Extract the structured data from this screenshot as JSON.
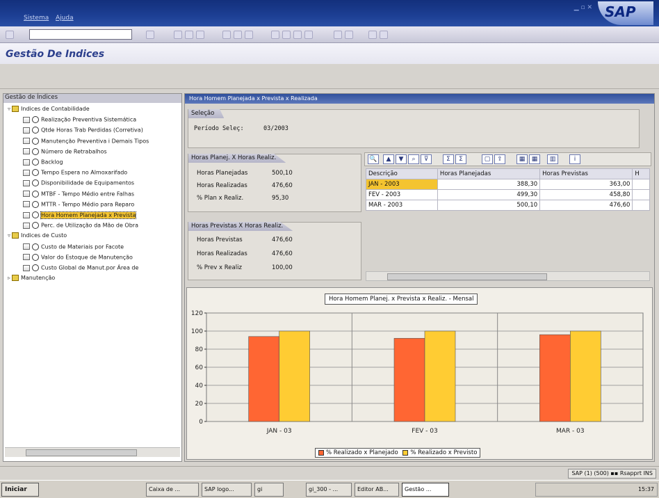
{
  "menu": {
    "items": [
      "Sistema",
      "Ajuda"
    ]
  },
  "brand": {
    "logo_text": "SAP"
  },
  "app": {
    "title": "Gestão De Indices"
  },
  "tree": {
    "header": "Gestão de Índices",
    "nodes": [
      {
        "label": "Indices de Contabilidade",
        "kind": "folder",
        "level": 0,
        "expanded": true
      },
      {
        "label": "Realização Preventiva Sistemática",
        "kind": "item",
        "level": 1
      },
      {
        "label": "Qtde Horas Trab Perdidas (Corretiva)",
        "kind": "item",
        "level": 1
      },
      {
        "label": "Manutenção Preventiva i Demais Tipos",
        "kind": "item",
        "level": 1
      },
      {
        "label": "Número de Retrabalhos",
        "kind": "item",
        "level": 1
      },
      {
        "label": "Backlog",
        "kind": "item",
        "level": 1
      },
      {
        "label": "Tempo Espera no Almoxarifado",
        "kind": "item",
        "level": 1
      },
      {
        "label": "Disponibilidade de Equipamentos",
        "kind": "item",
        "level": 1
      },
      {
        "label": "MTBF - Tempo Médio entre Falhas",
        "kind": "item",
        "level": 1
      },
      {
        "label": "MTTR - Tempo Médio para Reparo",
        "kind": "item",
        "level": 1
      },
      {
        "label": "Hora Homem Planejada x Prevista",
        "kind": "item",
        "level": 1,
        "selected": true
      },
      {
        "label": "Perc. de Utilização da Mão de Obra",
        "kind": "item",
        "level": 1
      },
      {
        "label": "Indices de Custo",
        "kind": "folder",
        "level": 0,
        "expanded": true
      },
      {
        "label": "Custo de Materiais por Facote",
        "kind": "item",
        "level": 1
      },
      {
        "label": "Valor do Estoque de Manutenção",
        "kind": "item",
        "level": 1
      },
      {
        "label": "Custo Global de Manut.por Área de",
        "kind": "item",
        "level": 1
      },
      {
        "label": "Manutenção",
        "kind": "folder",
        "level": 0,
        "expanded": false
      }
    ]
  },
  "panel": {
    "title": "Hora Homem Planejada x Prevista x Realizada",
    "selection": {
      "tab": "Seleção",
      "label": "Período Seleç:",
      "value": "03/2003"
    },
    "box1": {
      "tab": "Horas Planej. X Horas Realiz.",
      "rows": [
        {
          "label": "Horas Planejadas",
          "value": "500,10"
        },
        {
          "label": "Horas Realizadas",
          "value": "476,60"
        },
        {
          "label": "% Plan x Realiz.",
          "value": "95,30"
        }
      ]
    },
    "box2": {
      "tab": "Horas Previstas X Horas Realiz.",
      "rows": [
        {
          "label": "Horas Previstas",
          "value": "476,60"
        },
        {
          "label": "Horas Realizadas",
          "value": "476,60"
        },
        {
          "label": "% Prev x Realiz",
          "value": "100,00"
        }
      ]
    }
  },
  "grid": {
    "columns": [
      "Descrição",
      "Horas Planejadas",
      "Horas Previstas",
      "H"
    ],
    "rows": [
      {
        "desc": "JAN - 2003",
        "plan": "388,30",
        "prev": "363,00",
        "selected": true
      },
      {
        "desc": "FEV - 2003",
        "plan": "499,30",
        "prev": "458,80"
      },
      {
        "desc": "MAR - 2003",
        "plan": "500,10",
        "prev": "476,60"
      }
    ]
  },
  "chart_data": {
    "type": "bar",
    "title": "Hora Homem Planej. x Prevista x Realiz. - Mensal",
    "categories": [
      "JAN - 03",
      "FEV - 03",
      "MAR - 03"
    ],
    "series": [
      {
        "name": "% Realizado x Planejado",
        "values": [
          94,
          92,
          96
        ],
        "color": "#ff6633"
      },
      {
        "name": "% Realizado x Previsto",
        "values": [
          100,
          100,
          100
        ],
        "color": "#ffcc33"
      }
    ],
    "ylim": [
      0,
      120
    ],
    "yticks": [
      0,
      20,
      40,
      60,
      80,
      100,
      120
    ],
    "grid": true,
    "legend_position": "bottom"
  },
  "status": {
    "info": "SAP (1) (500) ▪▪ Rsapprt INS"
  },
  "taskbar": {
    "start": "Iniciar",
    "tasks": [
      "Caixa de ...",
      "SAP logo...",
      "gi",
      "gi_300 - ...",
      "Editor AB...",
      "Gestão ..."
    ],
    "clock": "15:37"
  }
}
